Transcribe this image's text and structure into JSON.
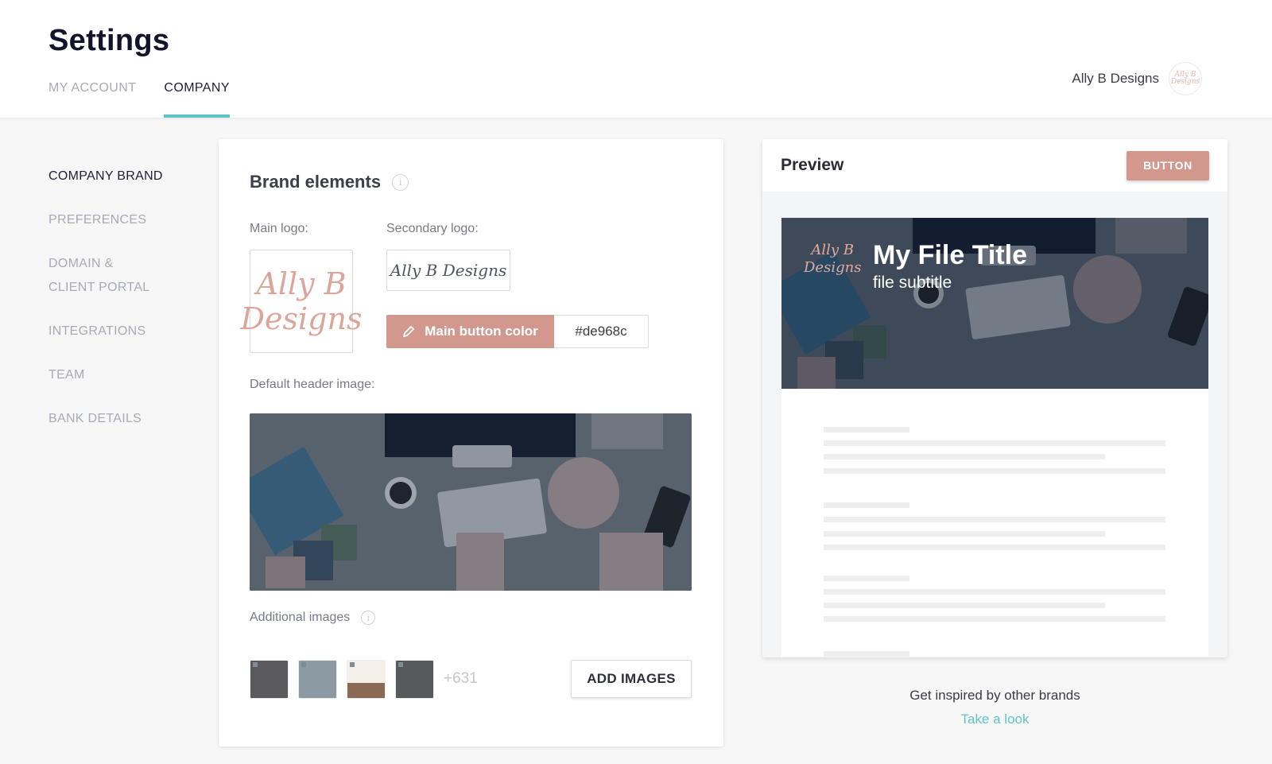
{
  "header": {
    "title": "Settings",
    "tabs": [
      {
        "label": "MY ACCOUNT",
        "active": false
      },
      {
        "label": "COMPANY",
        "active": true
      }
    ],
    "account_name": "Ally B Designs",
    "avatar_text": "Ally B Designs"
  },
  "sidebar": {
    "items": [
      {
        "label": "COMPANY BRAND",
        "active": true
      },
      {
        "label": "PREFERENCES",
        "active": false
      },
      {
        "label": "DOMAIN &",
        "label2": "CLIENT PORTAL",
        "active": false
      },
      {
        "label": "INTEGRATIONS",
        "active": false
      },
      {
        "label": "TEAM",
        "active": false
      },
      {
        "label": "BANK DETAILS",
        "active": false
      }
    ]
  },
  "brand": {
    "title": "Brand elements",
    "info_icon": "info-icon",
    "main_logo_label": "Main logo:",
    "main_logo_text_1": "Ally B",
    "main_logo_text_2": "Designs",
    "secondary_logo_label": "Secondary logo:",
    "secondary_logo_text": "Ally B Designs",
    "color_button_label": "Main button color",
    "color_button_icon": "pencil-icon",
    "color_value": "#de968c",
    "header_image_label": "Default header image:",
    "additional_images_label": "Additional images",
    "additional_images_more": "+631",
    "add_images_button": "ADD IMAGES"
  },
  "preview": {
    "title": "Preview",
    "button_label": "BUTTON",
    "file_title": "My File Title",
    "file_subtitle": "file subtitle",
    "logo_text_1": "Ally B",
    "logo_text_2": "Designs"
  },
  "inspire": {
    "text": "Get inspired by other brands",
    "link": "Take a look"
  },
  "colors": {
    "accent": "#5fc3c6",
    "brand_button": "#d3988d",
    "brand_hex_setting": "#de968c"
  }
}
